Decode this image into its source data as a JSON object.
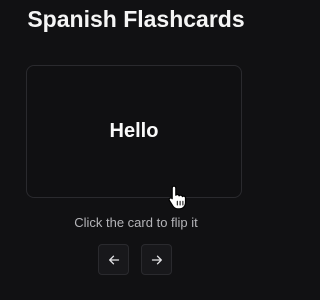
{
  "app": {
    "title": "Spanish Flashcards"
  },
  "card": {
    "word": "Hello"
  },
  "hint": "Click the card to flip it",
  "controls": {
    "prev_icon": "arrow-left-icon",
    "next_icon": "arrow-right-icon"
  },
  "colors": {
    "background": "#111113",
    "card_border": "#2a2a2e",
    "text": "#f4f4f5",
    "muted_text": "#b4b4b8"
  }
}
